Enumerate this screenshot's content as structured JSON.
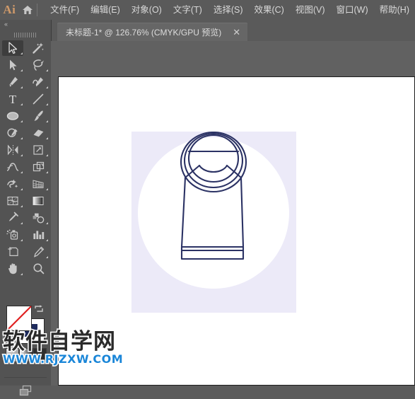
{
  "app": {
    "logo_text": "Ai",
    "logo_color": "#d09a6a",
    "home_icon": "home-icon"
  },
  "menubar": {
    "items": [
      {
        "label": "文件(F)"
      },
      {
        "label": "编辑(E)"
      },
      {
        "label": "对象(O)"
      },
      {
        "label": "文字(T)"
      },
      {
        "label": "选择(S)"
      },
      {
        "label": "效果(C)"
      },
      {
        "label": "视图(V)"
      },
      {
        "label": "窗口(W)"
      },
      {
        "label": "帮助(H)"
      }
    ]
  },
  "tabbar": {
    "document_tab": {
      "title": "未标题-1* @ 126.76% (CMYK/GPU 预览)",
      "close_label": "✕",
      "doc_name": "未标题-1",
      "modified": "*",
      "zoom": "126.76%",
      "color_mode": "CMYK",
      "gpu": "GPU 预览"
    }
  },
  "toolpanel": {
    "collapse_label": "«",
    "tools": [
      {
        "name": "selection-tool",
        "active": true
      },
      {
        "name": "magic-wand-tool",
        "active": false
      },
      {
        "name": "direct-selection-tool",
        "active": false
      },
      {
        "name": "lasso-tool",
        "active": false
      },
      {
        "name": "pen-tool",
        "active": false
      },
      {
        "name": "curvature-tool",
        "active": false
      },
      {
        "name": "type-tool",
        "active": false
      },
      {
        "name": "line-segment-tool",
        "active": false
      },
      {
        "name": "ellipse-tool",
        "active": false
      },
      {
        "name": "paintbrush-tool",
        "active": false
      },
      {
        "name": "shaper-tool",
        "active": false
      },
      {
        "name": "eraser-tool",
        "active": false
      },
      {
        "name": "rotate-tool",
        "active": false
      },
      {
        "name": "scale-tool",
        "active": false
      },
      {
        "name": "width-tool",
        "active": false
      },
      {
        "name": "free-transform-tool",
        "active": false
      },
      {
        "name": "shape-builder-tool",
        "active": false
      },
      {
        "name": "perspective-grid-tool",
        "active": false
      },
      {
        "name": "mesh-tool",
        "active": false
      },
      {
        "name": "gradient-tool",
        "active": false
      },
      {
        "name": "eyedropper-tool",
        "active": false
      },
      {
        "name": "blend-tool",
        "active": false
      },
      {
        "name": "symbol-sprayer-tool",
        "active": false
      },
      {
        "name": "column-graph-tool",
        "active": false
      },
      {
        "name": "artboard-tool",
        "active": false
      },
      {
        "name": "slice-tool",
        "active": false
      },
      {
        "name": "hand-tool",
        "active": false
      },
      {
        "name": "zoom-tool",
        "active": false
      }
    ],
    "fill_stroke": {
      "fill_name": "fill-swatch",
      "fill_value": "无",
      "fill_color": "#ffffff",
      "stroke_name": "stroke-swatch",
      "stroke_color": "#1d2a5c",
      "swap_icon": "swap-fill-stroke-icon",
      "default_icon": "default-fill-stroke-icon"
    },
    "color_modes": [
      {
        "name": "color-mode-color"
      },
      {
        "name": "color-mode-gradient"
      },
      {
        "name": "color-mode-none"
      }
    ],
    "screen_mode": {
      "name": "change-screen-mode-icon"
    }
  },
  "canvas": {
    "artboard_name": "artboard-1",
    "artwork": {
      "name": "turtleneck-sweater-illustration",
      "background_square_color": "#eceaf8",
      "circle_color": "#ffffff",
      "stroke_color": "#2b3264",
      "description": "高领毛衣图标"
    }
  },
  "watermark": {
    "title": "软件自学网",
    "url": "WWW.RJZXW.COM",
    "url_color": "#1a86d8"
  }
}
